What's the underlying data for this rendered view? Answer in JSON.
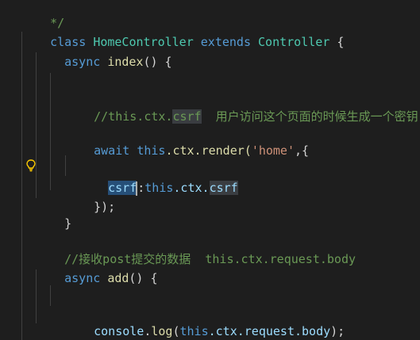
{
  "editor": {
    "line0_comment_end": "*/",
    "class_kw": "class",
    "class_name": "HomeController",
    "extends_kw": "extends",
    "parent_class": "Controller",
    "open_brace": " {",
    "async_kw": "async",
    "index_fn": "index",
    "parens_brace": "() {",
    "comment1_prefix": "//this.ctx.",
    "comment1_csrf": "csrf",
    "comment1_text": "  用户访问这个页面的时候生成一个密钥",
    "await_kw": "await",
    "this_kw": "this",
    "render_chain": ".ctx.render(",
    "render_arg": "'home'",
    "render_tail": ",{",
    "csrf_key": "csrf",
    "colon": ":",
    "this2": "this",
    "ctx_dot": ".ctx.",
    "csrf_val": "csrf",
    "close_obj": "});",
    "close_brace": "}",
    "comment2": "//接收post提交的数据  this.ctx.request.body",
    "async_kw2": "async",
    "add_fn": "add",
    "parens_brace2": "() {",
    "console_obj": "console",
    "dot_log": ".",
    "log_fn": "log",
    "log_open": "(",
    "this3": "this",
    "log_arg_rest": ".ctx.request.body",
    "log_close": ");",
    "close_brace2": "}"
  },
  "icons": {
    "lightbulb": "lightbulb-icon"
  },
  "colors": {
    "background": "#1e1e1e",
    "keyword": "#569cd6",
    "class": "#4ec9b0",
    "function": "#dcdcaa",
    "comment": "#6a9955",
    "string": "#ce9178",
    "variable": "#9cdcfe",
    "selection": "#264f78",
    "lightbulb": "#ffcc00"
  }
}
